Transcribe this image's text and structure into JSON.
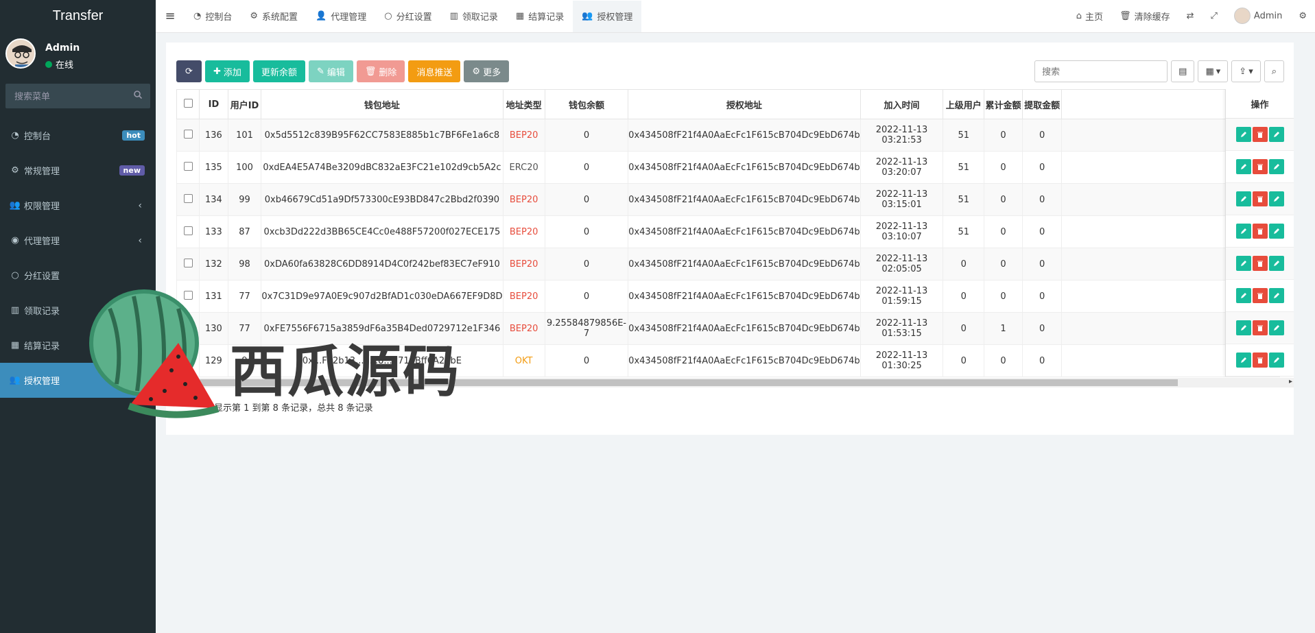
{
  "sidebar": {
    "logo": "Transfer",
    "user": {
      "name": "Admin",
      "status": "在线"
    },
    "search_placeholder": "搜索菜单",
    "items": [
      {
        "label": "控制台",
        "icon": "dashboard-icon",
        "badge": "hot",
        "badge_color": "#3c8dbc"
      },
      {
        "label": "常规管理",
        "icon": "cogs-icon",
        "badge": "new",
        "badge_color": "#605ca8"
      },
      {
        "label": "权限管理",
        "icon": "group-icon",
        "chevron": "‹"
      },
      {
        "label": "代理管理",
        "icon": "user-circle-icon",
        "chevron": "‹"
      },
      {
        "label": "分红设置",
        "icon": "circle-icon"
      },
      {
        "label": "领取记录",
        "icon": "bar-chart-icon"
      },
      {
        "label": "结算记录",
        "icon": "calculator-icon"
      },
      {
        "label": "授权管理",
        "icon": "group-icon",
        "active": true
      }
    ]
  },
  "topnav": {
    "tabs": [
      {
        "label": "控制台",
        "icon": "dashboard-icon"
      },
      {
        "label": "系统配置",
        "icon": "gear-icon"
      },
      {
        "label": "代理管理",
        "icon": "user-icon"
      },
      {
        "label": "分红设置",
        "icon": "circle-icon"
      },
      {
        "label": "领取记录",
        "icon": "bar-chart-icon"
      },
      {
        "label": "结算记录",
        "icon": "calculator-icon"
      },
      {
        "label": "授权管理",
        "icon": "group-icon",
        "active": true
      }
    ],
    "right": {
      "home": "主页",
      "clear_cache": "清除缓存",
      "user": "Admin"
    }
  },
  "toolbar": {
    "add": "添加",
    "update_balance": "更新余额",
    "edit": "编辑",
    "delete": "删除",
    "push": "消息推送",
    "more": "更多",
    "search_placeholder": "搜索"
  },
  "table": {
    "columns": [
      "ID",
      "用户ID",
      "钱包地址",
      "地址类型",
      "钱包余额",
      "授权地址",
      "加入时间",
      "上级用户",
      "累计金额",
      "提取金额",
      "",
      "操作"
    ],
    "rows": [
      {
        "id": "136",
        "uid": "101",
        "wallet": "0x5d5512c839B95F62CC7583E885b1c7BF6Fe1a6c8",
        "type": "BEP20",
        "balance": "0",
        "auth": "0x434508fF21f4A0AaEcFc1F615cB704Dc9EbD674b",
        "time": "2022-11-13 03:21:53",
        "parent": "51",
        "total": "0",
        "withdraw": "0"
      },
      {
        "id": "135",
        "uid": "100",
        "wallet": "0xdEA4E5A74Be3209dBC832aE3FC21e102d9cb5A2c",
        "type": "ERC20",
        "balance": "0",
        "auth": "0x434508fF21f4A0AaEcFc1F615cB704Dc9EbD674b",
        "time": "2022-11-13 03:20:07",
        "parent": "51",
        "total": "0",
        "withdraw": "0"
      },
      {
        "id": "134",
        "uid": "99",
        "wallet": "0xb46679Cd51a9Df573300cE93BD847c2Bbd2f0390",
        "type": "BEP20",
        "balance": "0",
        "auth": "0x434508fF21f4A0AaEcFc1F615cB704Dc9EbD674b",
        "time": "2022-11-13 03:15:01",
        "parent": "51",
        "total": "0",
        "withdraw": "0"
      },
      {
        "id": "133",
        "uid": "87",
        "wallet": "0xcb3Dd222d3BB65CE4Cc0e488F57200f027ECE175",
        "type": "BEP20",
        "balance": "0",
        "auth": "0x434508fF21f4A0AaEcFc1F615cB704Dc9EbD674b",
        "time": "2022-11-13 03:10:07",
        "parent": "51",
        "total": "0",
        "withdraw": "0"
      },
      {
        "id": "132",
        "uid": "98",
        "wallet": "0xDA60fa63828C6DD8914D4C0f242bef83EC7eF910",
        "type": "BEP20",
        "balance": "0",
        "auth": "0x434508fF21f4A0AaEcFc1F615cB704Dc9EbD674b",
        "time": "2022-11-13 02:05:05",
        "parent": "0",
        "total": "0",
        "withdraw": "0"
      },
      {
        "id": "131",
        "uid": "77",
        "wallet": "0x7C31D9e97A0E9c907d2BfAD1c030eDA667EF9D8D",
        "type": "BEP20",
        "balance": "0",
        "auth": "0x434508fF21f4A0AaEcFc1F615cB704Dc9EbD674b",
        "time": "2022-11-13 01:59:15",
        "parent": "0",
        "total": "0",
        "withdraw": "0"
      },
      {
        "id": "130",
        "uid": "77",
        "wallet": "0xFE7556F6715a3859dF6a35B4Ded0729712e1F346",
        "type": "BEP20",
        "balance": "9.25584879856E-7",
        "auth": "0x434508fF21f4A0AaEcFc1F615cB704Dc9EbD674b",
        "time": "2022-11-13 01:53:15",
        "parent": "0",
        "total": "1",
        "withdraw": "0"
      },
      {
        "id": "129",
        "uid": "9",
        "wallet": "0x...F12b13...7...8...3714Bff6A27bE",
        "type": "OKT",
        "balance": "0",
        "auth": "0x434508fF21f4A0AaEcFc1F615cB704Dc9EbD674b",
        "time": "2022-11-13 01:30:25",
        "parent": "0",
        "total": "0",
        "withdraw": "0"
      }
    ]
  },
  "pagination": {
    "info": "显示第 1 到第 8 条记录，总共 8 条记录"
  },
  "watermark": {
    "text": "西瓜源码"
  },
  "colors": {
    "sidebar_bg": "#222d32",
    "active": "#3c8dbc",
    "success": "#18bc9c",
    "danger": "#e74c3c",
    "warning": "#f39c12"
  }
}
